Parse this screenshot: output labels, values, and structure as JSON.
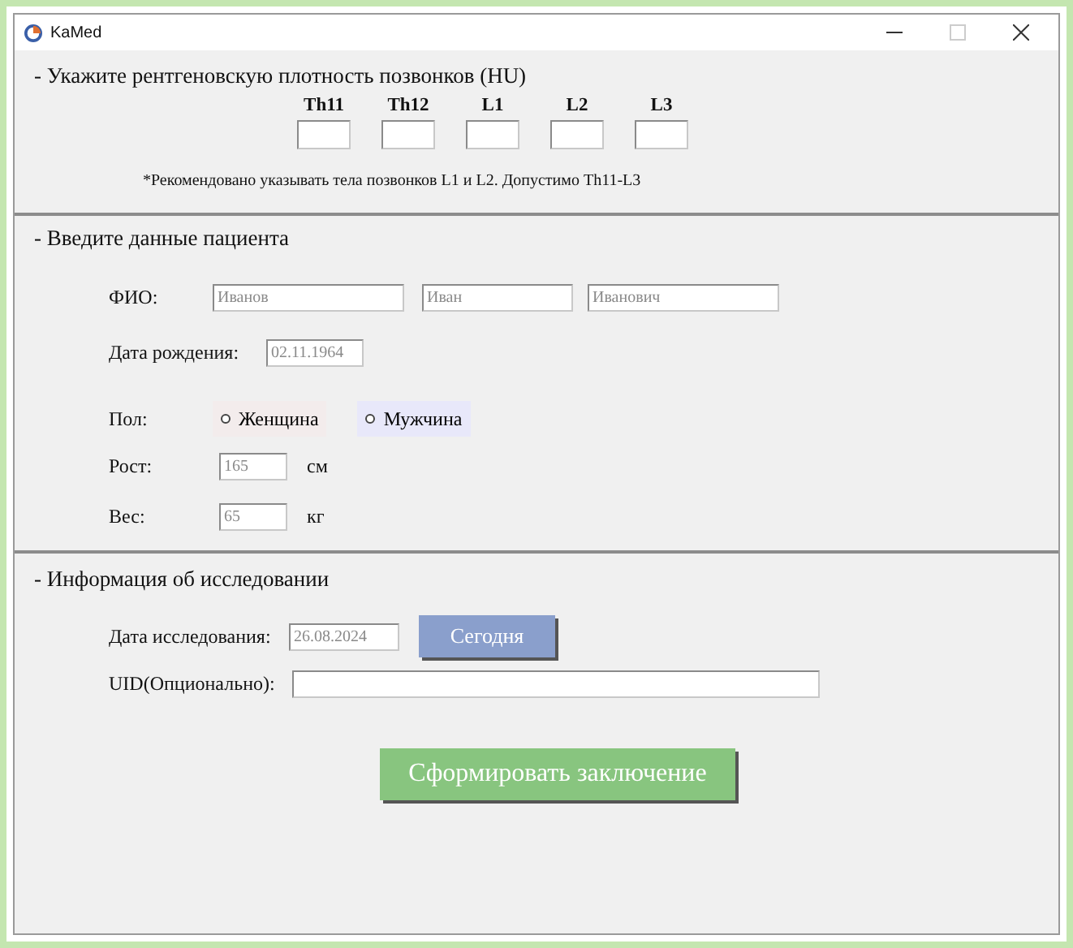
{
  "window": {
    "title": "KaMed"
  },
  "density": {
    "heading": "- Укажите рентгеновскую плотность позвонков (HU)",
    "vertebrae": [
      {
        "label": "Th11"
      },
      {
        "label": "Th12"
      },
      {
        "label": "L1"
      },
      {
        "label": "L2"
      },
      {
        "label": "L3"
      }
    ],
    "note": "*Рекомендовано указывать тела позвонков L1 и L2. Допустимо Th11-L3"
  },
  "patient": {
    "heading": "- Введите данные пациента",
    "name_label": "ФИО:",
    "name_fields": [
      {
        "placeholder": "Иванов"
      },
      {
        "placeholder": "Иван"
      },
      {
        "placeholder": "Иванович"
      }
    ],
    "birth_label": "Дата рождения:",
    "birth_field": {
      "placeholder": "02.11.1964"
    },
    "sex_label": "Пол:",
    "sex_options": [
      {
        "label": "Женщина",
        "selected": false,
        "color": "#f3ecec"
      },
      {
        "label": "Мужчина",
        "selected": false,
        "color": "#e8e8fa"
      }
    ],
    "height_label": "Рост:",
    "height_field": {
      "placeholder": "165"
    },
    "height_unit": "см",
    "weight_label": "Вес:",
    "weight_field": {
      "placeholder": "65"
    },
    "weight_unit": "кг"
  },
  "study": {
    "heading": "- Информация об исследовании",
    "date_label": "Дата исследования:",
    "date_field": {
      "placeholder": "26.08.2024"
    },
    "today_button": "Сегодня",
    "uid_label": "UID(Опционально):"
  },
  "submit_button": "Сформировать заключение"
}
